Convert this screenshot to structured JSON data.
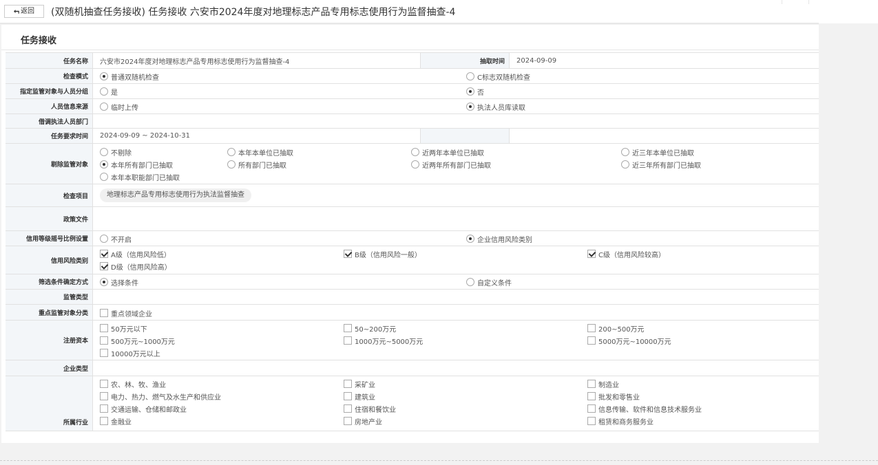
{
  "header": {
    "back_label": "返回",
    "back_icon": "return-arrow-icon",
    "title": "(双随机抽查任务接收) 任务接收 六安市2024年度对地理标志产品专用标志使用行为监督抽查-4"
  },
  "card": {
    "title": "任务接收"
  },
  "form": {
    "task_name": {
      "label": "任务名称",
      "value": "六安市2024年度对地理标志产品专用标志使用行为监督抽查-4",
      "extract_label": "抽取时间",
      "extract_value": "2024-09-09"
    },
    "check_mode": {
      "label": "检查模式",
      "options": [
        "普通双随机检查",
        "C标志双随机检查"
      ],
      "selected": 0
    },
    "assign_group": {
      "label": "指定监管对象与人员分组",
      "options": [
        "是",
        "否"
      ],
      "selected": 1
    },
    "person_source": {
      "label": "人员信息来源",
      "options": [
        "临时上传",
        "执法人员库读取"
      ],
      "selected": 1
    },
    "borrow_dept": {
      "label": "借调执法人员部门",
      "value": ""
    },
    "task_time": {
      "label": "任务要求时间",
      "value": "2024-09-09 ~ 2024-10-31"
    },
    "exclude": {
      "label": "剔除监管对象",
      "options": [
        "不剔除",
        "本年本单位已抽取",
        "近两年本单位已抽取",
        "近三年本单位已抽取",
        "本年所有部门已抽取",
        "所有部门已抽取",
        "近两年所有部门已抽取",
        "近三年所有部门已抽取",
        "本年本职能部门已抽取"
      ],
      "selected": 4
    },
    "check_item": {
      "label": "检查项目",
      "tag": "地理标志产品专用标志使用行为执法监督抽查"
    },
    "policy": {
      "label": "政策文件",
      "value": ""
    },
    "credit_setting": {
      "label": "信用等级摇号比例设置",
      "options": [
        "不开启",
        "企业信用风险类别"
      ],
      "selected": 1
    },
    "credit_risk": {
      "label": "信用风险类别",
      "options": [
        "A级（信用风险低）",
        "B级（信用风险一般）",
        "C级（信用风险较高）",
        "D级（信用风险高）"
      ],
      "checked": [
        true,
        true,
        true,
        true
      ]
    },
    "filter_mode": {
      "label": "筛选条件确定方式",
      "options": [
        "选择条件",
        "自定义条件"
      ],
      "selected": 0
    },
    "supervise_type": {
      "label": "监管类型",
      "value": ""
    },
    "key_object": {
      "label": "重点监管对象分类",
      "options": [
        "重点领域企业"
      ],
      "checked": [
        false
      ]
    },
    "capital": {
      "label": "注册资本",
      "options": [
        "50万元以下",
        "50~200万元",
        "200~500万元",
        "500万元~1000万元",
        "1000万元~5000万元",
        "5000万元~10000万元",
        "10000万元以上"
      ],
      "checked": [
        false,
        false,
        false,
        false,
        false,
        false,
        false
      ]
    },
    "company_type": {
      "label": "企业类型",
      "value": ""
    },
    "industry": {
      "label": "所属行业",
      "options": [
        "农、林、牧、渔业",
        "采矿业",
        "制造业",
        "电力、热力、燃气及水生产和供应业",
        "建筑业",
        "批发和零售业",
        "交通运输、仓储和邮政业",
        "住宿和餐饮业",
        "信息传输、软件和信息技术服务业",
        "金融业",
        "房地产业",
        "租赁和商务服务业"
      ],
      "checked": [
        false,
        false,
        false,
        false,
        false,
        false,
        false,
        false,
        false,
        false,
        false,
        false
      ]
    }
  }
}
